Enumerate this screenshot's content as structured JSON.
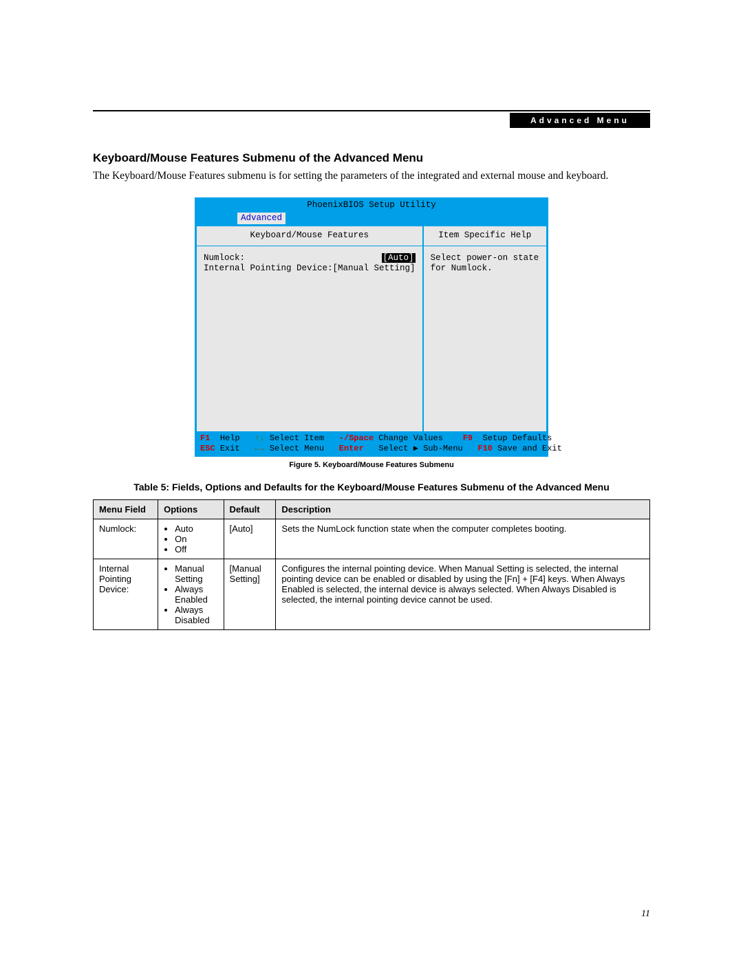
{
  "header": {
    "section_label": "Advanced Menu"
  },
  "section_title": "Keyboard/Mouse Features Submenu of the Advanced Menu",
  "intro_text": "The Keyboard/Mouse Features submenu is for setting the parameters of the integrated and external mouse and keyboard.",
  "bios": {
    "title": "PhoenixBIOS Setup Utility",
    "active_tab": "Advanced",
    "left_panel_title": "Keyboard/Mouse Features",
    "right_panel_title": "Item Specific Help",
    "help_text_line1": "Select power-on state",
    "help_text_line2": "for Numlock.",
    "rows": [
      {
        "label": "Numlock:",
        "value": "[Auto]",
        "selected": true
      },
      {
        "label": "Internal Pointing Device:",
        "value": "[Manual Setting]",
        "selected": false
      }
    ],
    "footer": {
      "r1": {
        "k1": "F1",
        "a1": "Help",
        "k2": "↑↓",
        "a2": "Select Item",
        "k3": "-/Space",
        "a3": "Change Values",
        "k4": "F9",
        "a4": "Setup Defaults"
      },
      "r2": {
        "k1": "ESC",
        "a1": "Exit",
        "k2": "←→",
        "a2": "Select Menu",
        "k3": "Enter",
        "a3": "Select ▶ Sub-Menu",
        "k4": "F10",
        "a4": "Save and Exit"
      }
    }
  },
  "figure_caption": "Figure 5.  Keyboard/Mouse Features Submenu",
  "table_title": "Table 5: Fields, Options and Defaults for the Keyboard/Mouse Features Submenu of the Advanced Menu",
  "table": {
    "headers": [
      "Menu Field",
      "Options",
      "Default",
      "Description"
    ],
    "rows": [
      {
        "field": "Numlock:",
        "options": [
          "Auto",
          "On",
          "Off"
        ],
        "default": "[Auto]",
        "description": "Sets the NumLock function state when the computer completes booting."
      },
      {
        "field": "Internal Pointing Device:",
        "options": [
          "Manual Setting",
          "Always Enabled",
          "Always Disabled"
        ],
        "default": "[Manual Setting]",
        "description": "Configures the internal pointing device. When Manual Setting is selected, the internal pointing device can be enabled or disabled by using the [Fn] + [F4] keys. When Always Enabled is selected, the internal device is always selected. When Always Disabled is selected, the internal pointing device cannot be used."
      }
    ]
  },
  "page_number": "11"
}
